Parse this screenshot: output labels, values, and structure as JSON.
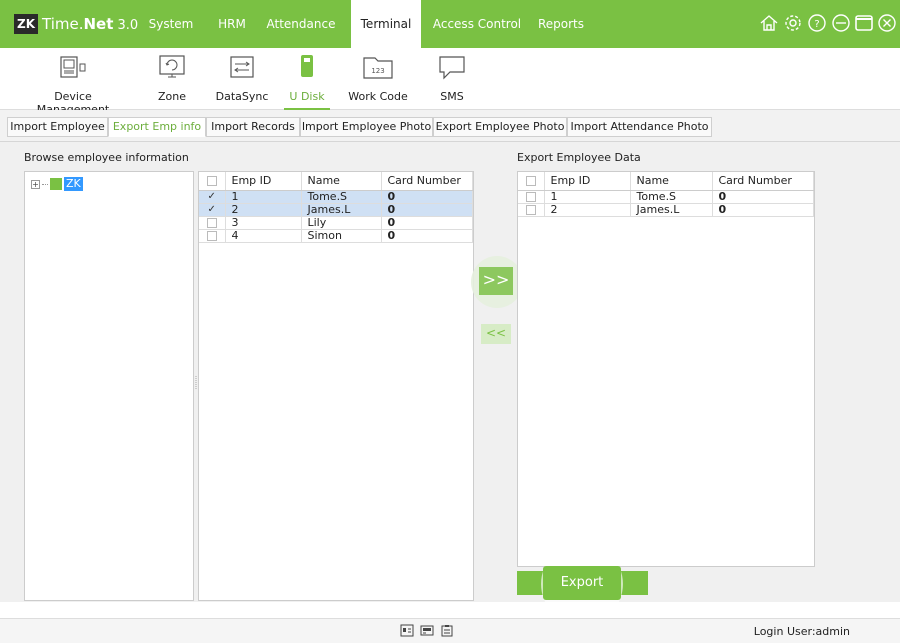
{
  "app": {
    "logo_mark": "ZK",
    "logo_name": "Time.",
    "logo_name_bold": "Net",
    "logo_version": " 3.0"
  },
  "menu": {
    "items": [
      {
        "label": "System"
      },
      {
        "label": "HRM"
      },
      {
        "label": "Attendance"
      },
      {
        "label": "Terminal"
      },
      {
        "label": "Access Control"
      },
      {
        "label": "Reports"
      }
    ],
    "active": "Terminal"
  },
  "window_icons": [
    "home-icon",
    "settings-icon",
    "help-icon",
    "minimize-icon",
    "maximize-icon",
    "close-icon"
  ],
  "toolbar": {
    "items": [
      {
        "label": "Device Management",
        "icon": "device-icon"
      },
      {
        "label": "Zone",
        "icon": "zone-icon"
      },
      {
        "label": "DataSync",
        "icon": "datasync-icon"
      },
      {
        "label": "U Disk",
        "icon": "udisk-icon"
      },
      {
        "label": "Work Code",
        "icon": "workcode-icon",
        "icon_text": "123"
      },
      {
        "label": "SMS",
        "icon": "sms-icon"
      }
    ],
    "active": "U Disk"
  },
  "subtabs": {
    "items": [
      {
        "label": "Import Employee"
      },
      {
        "label": "Export Emp info"
      },
      {
        "label": "Import Records"
      },
      {
        "label": "Import Employee Photo"
      },
      {
        "label": "Export Employee Photo"
      },
      {
        "label": "Import Attendance Photo"
      }
    ],
    "active": "Export Emp info"
  },
  "browse": {
    "title": "Browse employee information",
    "tree": {
      "expander": "+",
      "root_label": "ZK"
    }
  },
  "employee_grid": {
    "columns": [
      "Emp ID",
      "Name",
      "Card Number"
    ],
    "rows": [
      {
        "checked": true,
        "emp_id": "1",
        "name": "Tome.S",
        "card": "0",
        "selected": true
      },
      {
        "checked": true,
        "emp_id": "2",
        "name": "James.L",
        "card": "0",
        "selected": true
      },
      {
        "checked": false,
        "emp_id": "3",
        "name": "Lily",
        "card": "0",
        "selected": false
      },
      {
        "checked": false,
        "emp_id": "4",
        "name": "Simon",
        "card": "0",
        "selected": false
      }
    ]
  },
  "move_right_label": ">>",
  "move_left_label": "<<",
  "export_data": {
    "title": "Export Employee Data",
    "columns": [
      "Emp ID",
      "Name",
      "Card Number"
    ],
    "rows": [
      {
        "emp_id": "1",
        "name": "Tome.S",
        "card": "0"
      },
      {
        "emp_id": "2",
        "name": "James.L",
        "card": "0"
      }
    ]
  },
  "export_button": "Export",
  "status": {
    "icons": [
      "id-card-icon",
      "card-reader-icon",
      "clipboard-icon"
    ],
    "login_user": "Login User:admin"
  },
  "colors": {
    "brand": "#7ac143",
    "selection": "#cfe0f4",
    "tree_selection": "#3399ff"
  }
}
